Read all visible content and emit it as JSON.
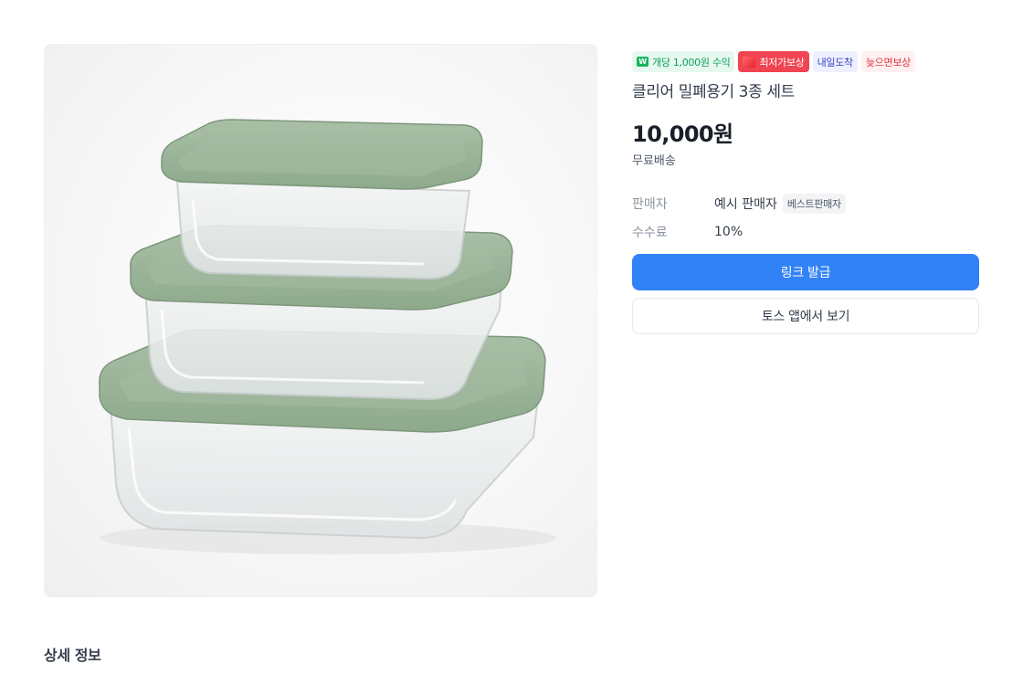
{
  "product": {
    "image_alt": "glass-containers-with-green-lids",
    "badges": {
      "profit": "개당 1,000원 수익",
      "profit_icon": "W",
      "lowest": "최저가보상",
      "tomorrow": "내일도착",
      "late": "늦으면보상"
    },
    "title": "클리어 밀폐용기 3종 세트",
    "price": "10,000원",
    "shipping": "무료배송",
    "seller": {
      "label": "판매자",
      "value": "예시 판매자",
      "badge": "베스트판매자"
    },
    "commission": {
      "label": "수수료",
      "value": "10%"
    }
  },
  "actions": {
    "issue_link": "링크 발급",
    "view_in_app": "토스 앱에서 보기"
  },
  "detail_section": {
    "title": "상세 정보"
  },
  "colors": {
    "primary": "#3182f6",
    "lid_green": "#9bb49a",
    "badge_red": "#f04452"
  }
}
